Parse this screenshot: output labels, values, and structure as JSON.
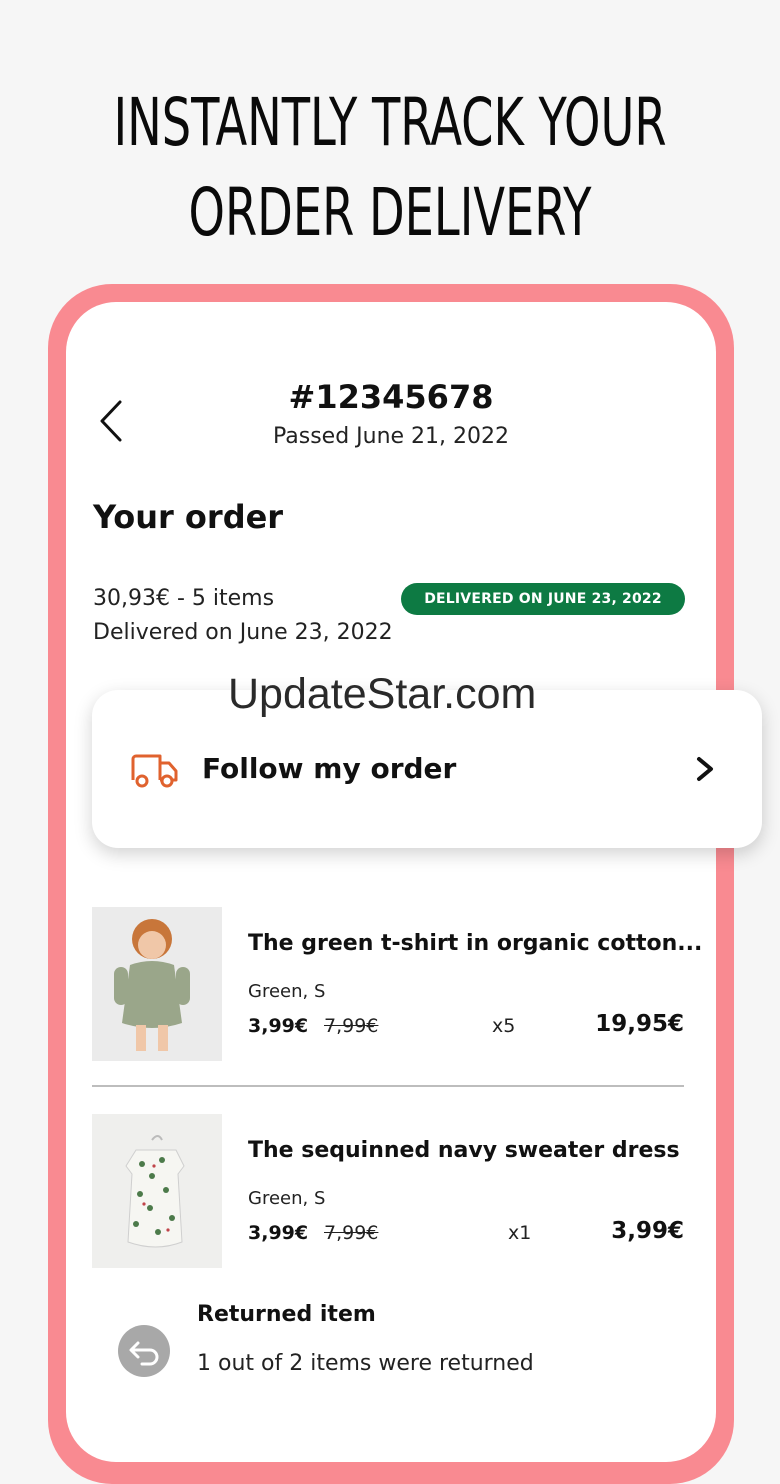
{
  "headline": {
    "line1": "INSTANTLY TRACK YOUR",
    "line2": "ORDER DELIVERY"
  },
  "header": {
    "back_icon": "chevron-left-icon",
    "order_number": "#12345678",
    "order_date": "Passed June 21, 2022"
  },
  "order": {
    "section_title": "Your order",
    "summary": "30,93€ - 5 items",
    "delivered": "Delivered on June 23, 2022",
    "badge": "DELIVERED ON JUNE 23, 2022",
    "badge_color": "#0d7a43"
  },
  "watermark": "UpdateStar.com",
  "follow": {
    "icon": "truck-icon",
    "label": "Follow my order",
    "chevron": "chevron-right-icon"
  },
  "items": [
    {
      "name": "The green t-shirt in organic cotton...",
      "variant": "Green, S",
      "price": "3,99€",
      "old_price": "7,99€",
      "qty": "x5",
      "total": "19,95€"
    },
    {
      "name": "The sequinned navy sweater dress",
      "variant": "Green, S",
      "price": "3,99€",
      "old_price": "7,99€",
      "qty": "x1",
      "total": "3,99€"
    }
  ],
  "returned": {
    "icon": "return-arrow-icon",
    "title": "Returned item",
    "subtitle": "1 out of 2 items were returned"
  },
  "colors": {
    "frame": "#f98a91",
    "accent_truck": "#e0622e"
  }
}
